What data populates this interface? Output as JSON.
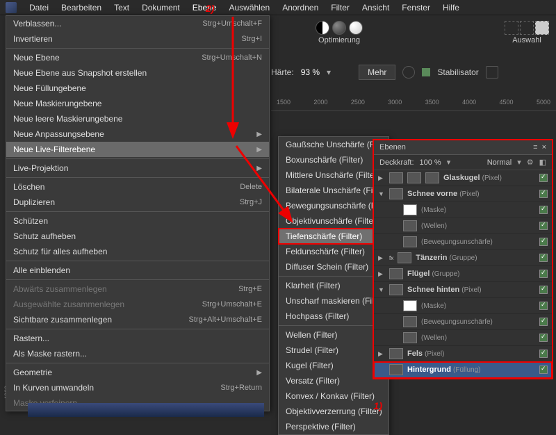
{
  "menubar": {
    "items": [
      "Datei",
      "Bearbeiten",
      "Text",
      "Dokument",
      "Ebene",
      "Auswählen",
      "Anordnen",
      "Filter",
      "Ansicht",
      "Fenster",
      "Hilfe"
    ],
    "active_index": 4
  },
  "optimierung_label": "Optimierung",
  "auswahl_label": "Auswahl",
  "toolbar": {
    "haerte_label": "Härte:",
    "haerte_value": "93 %",
    "mehr_label": "Mehr",
    "stabilisator_label": "Stabilisator"
  },
  "ruler_ticks": [
    "1500",
    "2000",
    "2500",
    "3000",
    "3500",
    "4000",
    "4500",
    "5000"
  ],
  "left_ruler": "4000",
  "dropdown": {
    "items": [
      {
        "label": "Verblassen...",
        "shortcut": "Strg+Umschalt+F"
      },
      {
        "label": "Invertieren",
        "shortcut": "Strg+I"
      },
      {
        "sep": true
      },
      {
        "label": "Neue Ebene",
        "shortcut": "Strg+Umschalt+N"
      },
      {
        "label": "Neue Ebene aus Snapshot erstellen"
      },
      {
        "label": "Neue Füllungebene"
      },
      {
        "label": "Neue Maskierungebene"
      },
      {
        "label": "Neue leere Maskierungebene"
      },
      {
        "label": "Neue Anpassungsebene",
        "submenu": true
      },
      {
        "label": "Neue Live-Filterebene",
        "submenu": true,
        "highlight": true
      },
      {
        "sep": true
      },
      {
        "label": "Live-Projektion",
        "submenu": true
      },
      {
        "sep": true
      },
      {
        "label": "Löschen",
        "shortcut": "Delete"
      },
      {
        "label": "Duplizieren",
        "shortcut": "Strg+J"
      },
      {
        "sep": true
      },
      {
        "label": "Schützen"
      },
      {
        "label": "Schutz aufheben"
      },
      {
        "label": "Schutz für alles aufheben"
      },
      {
        "sep": true
      },
      {
        "label": "Alle einblenden"
      },
      {
        "sep": true
      },
      {
        "label": "Abwärts zusammenlegen",
        "shortcut": "Strg+E",
        "disabled": true
      },
      {
        "label": "Ausgewählte zusammenlegen",
        "shortcut": "Strg+Umschalt+E",
        "disabled": true
      },
      {
        "label": "Sichtbare zusammenlegen",
        "shortcut": "Strg+Alt+Umschalt+E"
      },
      {
        "sep": true
      },
      {
        "label": "Rastern..."
      },
      {
        "label": "Als Maske rastern..."
      },
      {
        "sep": true
      },
      {
        "label": "Geometrie",
        "submenu": true
      },
      {
        "label": "In Kurven umwandeln",
        "shortcut": "Strg+Return"
      },
      {
        "label": "Maske verfeinern...",
        "disabled": true
      }
    ]
  },
  "submenu": {
    "items": [
      {
        "label": "Gaußsche Unschärfe (Filter)"
      },
      {
        "label": "Boxunschärfe (Filter)"
      },
      {
        "label": "Mittlere Unschärfe (Filter)"
      },
      {
        "label": "Bilaterale Unschärfe (Filter)"
      },
      {
        "label": "Bewegungsunschärfe (Filter)"
      },
      {
        "label": "Objektivunschärfe (Filter)"
      },
      {
        "label": "Tiefenschärfe (Filter)",
        "highlight": true
      },
      {
        "label": "Feldunschärfe (Filter)"
      },
      {
        "label": "Diffuser Schein (Filter)"
      },
      {
        "sep": true
      },
      {
        "label": "Klarheit (Filter)"
      },
      {
        "label": "Unscharf maskieren (Filter)"
      },
      {
        "label": "Hochpass (Filter)"
      },
      {
        "sep": true
      },
      {
        "label": "Wellen (Filter)"
      },
      {
        "label": "Strudel (Filter)"
      },
      {
        "label": "Kugel (Filter)"
      },
      {
        "label": "Versatz (Filter)"
      },
      {
        "label": "Konvex / Konkav (Filter)"
      },
      {
        "label": "Objektivverzerrung (Filter)"
      },
      {
        "label": "Perspektive (Filter)"
      }
    ]
  },
  "layers": {
    "tab_label": "Ebenen",
    "opacity_label": "Deckkraft:",
    "opacity_value": "100 %",
    "blend_mode": "Normal",
    "rows": [
      {
        "tri": "▶",
        "name": "Glaskugel",
        "type": "(Pixel)",
        "indent": 0,
        "thumbs": 3
      },
      {
        "tri": "▼",
        "name": "Schnee vorne",
        "type": "(Pixel)",
        "indent": 0,
        "thumbs": 1
      },
      {
        "name": "(Maske)",
        "indent": 1,
        "thumbs": 1,
        "white": true,
        "nolabel": true
      },
      {
        "name": "(Wellen)",
        "indent": 1,
        "thumbs": 1,
        "nolabel": true
      },
      {
        "name": "(Bewegungsunschärfe)",
        "indent": 1,
        "thumbs": 1,
        "nolabel": true
      },
      {
        "tri": "▶",
        "name": "Tänzerin",
        "type": "(Gruppe)",
        "indent": 0,
        "thumbs": 1,
        "fx": true
      },
      {
        "tri": "▶",
        "name": "Flügel",
        "type": "(Gruppe)",
        "indent": 0,
        "thumbs": 1
      },
      {
        "tri": "▼",
        "name": "Schnee hinten",
        "type": "(Pixel)",
        "indent": 0,
        "thumbs": 1
      },
      {
        "name": "(Maske)",
        "indent": 1,
        "thumbs": 1,
        "white": true,
        "nolabel": true
      },
      {
        "name": "(Bewegungsunschärfe)",
        "indent": 1,
        "thumbs": 1,
        "nolabel": true
      },
      {
        "name": "(Wellen)",
        "indent": 1,
        "thumbs": 1,
        "nolabel": true
      },
      {
        "tri": "▶",
        "name": "Fels",
        "type": "(Pixel)",
        "indent": 0,
        "thumbs": 1
      },
      {
        "name": "Hintergrund",
        "type": "(Füllung)",
        "indent": 0,
        "thumbs": 1,
        "selected": true
      }
    ]
  },
  "annotations": {
    "step1": "1)",
    "step2": "2)"
  }
}
